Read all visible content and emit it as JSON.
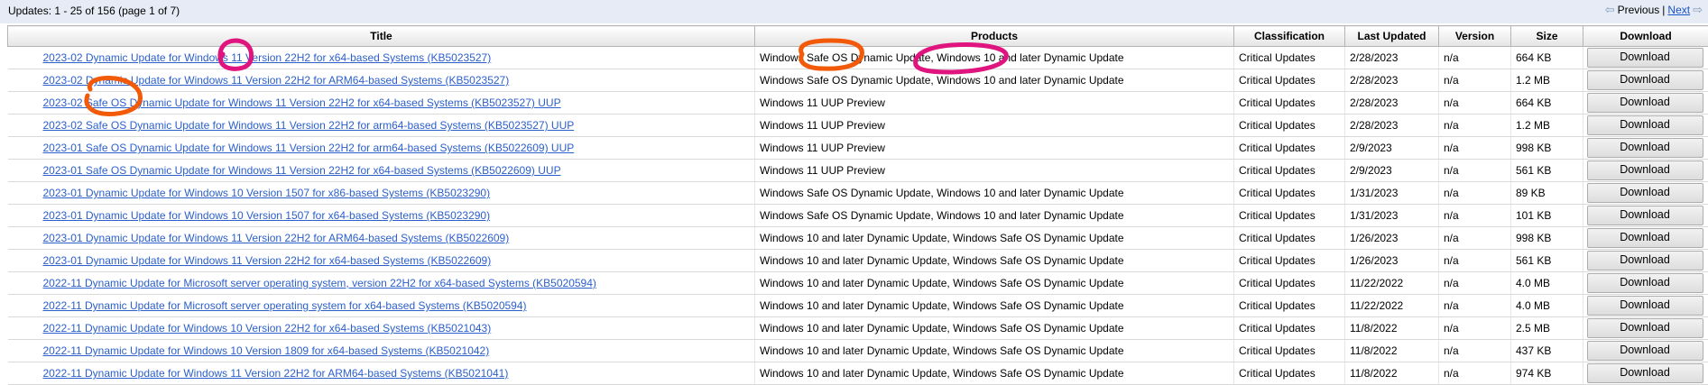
{
  "header": {
    "summary": "Updates: 1 - 25 of 156 (page 1 of 7)",
    "previous_label": "Previous",
    "separator": "|",
    "next_label": "Next"
  },
  "columns": [
    "Title",
    "Products",
    "Classification",
    "Last Updated",
    "Version",
    "Size",
    "Download"
  ],
  "download_label": "Download",
  "rows": [
    {
      "title": "2023-02 Dynamic Update for Windows 11 Version 22H2 for x64-based Systems (KB5023527)",
      "products": "Windows Safe OS Dynamic Update, Windows 10 and later Dynamic Update",
      "classification": "Critical Updates",
      "last_updated": "2/28/2023",
      "version": "n/a",
      "size": "664 KB"
    },
    {
      "title": "2023-02 Dynamic Update for Windows 11 Version 22H2 for ARM64-based Systems (KB5023527)",
      "products": "Windows Safe OS Dynamic Update, Windows 10 and later Dynamic Update",
      "classification": "Critical Updates",
      "last_updated": "2/28/2023",
      "version": "n/a",
      "size": "1.2 MB"
    },
    {
      "title": "2023-02 Safe OS Dynamic Update for Windows 11 Version 22H2 for x64-based Systems (KB5023527) UUP",
      "products": "Windows 11 UUP Preview",
      "classification": "Critical Updates",
      "last_updated": "2/28/2023",
      "version": "n/a",
      "size": "664 KB"
    },
    {
      "title": "2023-02 Safe OS Dynamic Update for Windows 11 Version 22H2 for arm64-based Systems (KB5023527) UUP",
      "products": "Windows 11 UUP Preview",
      "classification": "Critical Updates",
      "last_updated": "2/28/2023",
      "version": "n/a",
      "size": "1.2 MB"
    },
    {
      "title": "2023-01 Safe OS Dynamic Update for Windows 11 Version 22H2 for arm64-based Systems (KB5022609) UUP",
      "products": "Windows 11 UUP Preview",
      "classification": "Critical Updates",
      "last_updated": "2/9/2023",
      "version": "n/a",
      "size": "998 KB"
    },
    {
      "title": "2023-01 Safe OS Dynamic Update for Windows 11 Version 22H2 for x64-based Systems (KB5022609) UUP",
      "products": "Windows 11 UUP Preview",
      "classification": "Critical Updates",
      "last_updated": "2/9/2023",
      "version": "n/a",
      "size": "561 KB"
    },
    {
      "title": "2023-01 Dynamic Update for Windows 10 Version 1507 for x86-based Systems (KB5023290)",
      "products": "Windows Safe OS Dynamic Update, Windows 10 and later Dynamic Update",
      "classification": "Critical Updates",
      "last_updated": "1/31/2023",
      "version": "n/a",
      "size": "89 KB"
    },
    {
      "title": "2023-01 Dynamic Update for Windows 10 Version 1507 for x64-based Systems (KB5023290)",
      "products": "Windows Safe OS Dynamic Update, Windows 10 and later Dynamic Update",
      "classification": "Critical Updates",
      "last_updated": "1/31/2023",
      "version": "n/a",
      "size": "101 KB"
    },
    {
      "title": "2023-01 Dynamic Update for Windows 11 Version 22H2 for ARM64-based Systems (KB5022609)",
      "products": "Windows 10 and later Dynamic Update, Windows Safe OS Dynamic Update",
      "classification": "Critical Updates",
      "last_updated": "1/26/2023",
      "version": "n/a",
      "size": "998 KB"
    },
    {
      "title": "2023-01 Dynamic Update for Windows 11 Version 22H2 for x64-based Systems (KB5022609)",
      "products": "Windows 10 and later Dynamic Update, Windows Safe OS Dynamic Update",
      "classification": "Critical Updates",
      "last_updated": "1/26/2023",
      "version": "n/a",
      "size": "561 KB"
    },
    {
      "title": "2022-11 Dynamic Update for Microsoft server operating system, version 22H2 for x64-based Systems (KB5020594)",
      "products": "Windows 10 and later Dynamic Update, Windows Safe OS Dynamic Update",
      "classification": "Critical Updates",
      "last_updated": "11/22/2022",
      "version": "n/a",
      "size": "4.0 MB"
    },
    {
      "title": "2022-11 Dynamic Update for Microsoft server operating system for x64-based Systems (KB5020594)",
      "products": "Windows 10 and later Dynamic Update, Windows Safe OS Dynamic Update",
      "classification": "Critical Updates",
      "last_updated": "11/22/2022",
      "version": "n/a",
      "size": "4.0 MB"
    },
    {
      "title": "2022-11 Dynamic Update for Windows 10 Version 22H2 for x64-based Systems (KB5021043)",
      "products": "Windows 10 and later Dynamic Update, Windows Safe OS Dynamic Update",
      "classification": "Critical Updates",
      "last_updated": "11/8/2022",
      "version": "n/a",
      "size": "2.5 MB"
    },
    {
      "title": "2022-11 Dynamic Update for Windows 10 Version 1809 for x64-based Systems (KB5021042)",
      "products": "Windows 10 and later Dynamic Update, Windows Safe OS Dynamic Update",
      "classification": "Critical Updates",
      "last_updated": "11/8/2022",
      "version": "n/a",
      "size": "437 KB"
    },
    {
      "title": "2022-11 Dynamic Update for Windows 11 Version 22H2 for ARM64-based Systems (KB5021041)",
      "products": "Windows 10 and later Dynamic Update, Windows Safe OS Dynamic Update",
      "classification": "Critical Updates",
      "last_updated": "11/8/2022",
      "version": "n/a",
      "size": "974 KB"
    }
  ],
  "colors": {
    "link": "#2b5fcc",
    "header_bar": "#e6ebf5",
    "annotation_magenta": "#e0147e",
    "annotation_orange": "#f25a0a"
  }
}
